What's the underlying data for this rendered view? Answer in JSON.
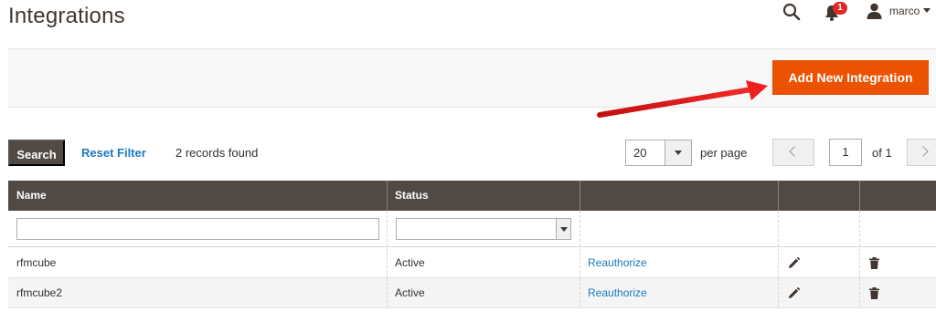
{
  "header": {
    "title": "Integrations",
    "notifications_count": "1",
    "user_name": "marco"
  },
  "actions": {
    "add_label": "Add New Integration"
  },
  "toolbar": {
    "search_label": "Search",
    "reset_label": "Reset Filter",
    "records_found": "2 records found",
    "per_page_value": "20",
    "per_page_label": "per page",
    "current_page": "1",
    "of_pages": "of 1"
  },
  "grid": {
    "columns": [
      "Name",
      "Status",
      "",
      "",
      ""
    ],
    "filters": {
      "name_value": "",
      "status_value": ""
    },
    "rows": [
      {
        "name": "rfmcube",
        "status": "Active",
        "action": "Reauthorize"
      },
      {
        "name": "rfmcube2",
        "status": "Active",
        "action": "Reauthorize"
      }
    ]
  },
  "colors": {
    "accent": "#eb5202",
    "header_bg": "#514943",
    "link": "#1979c3",
    "annotation_arrow": "#e51b1b"
  },
  "icons": {
    "search": "search-icon",
    "notifications": "bell-icon",
    "user": "user-icon",
    "edit": "pencil-icon",
    "delete": "trash-icon"
  }
}
